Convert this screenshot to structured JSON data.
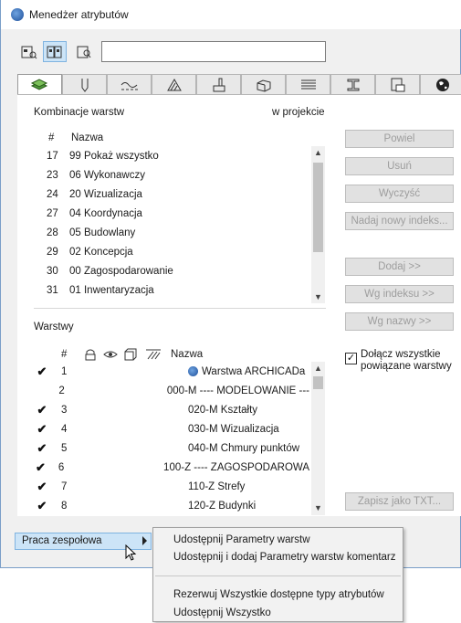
{
  "window": {
    "title": "Menedżer atrybutów"
  },
  "toolbar": {
    "buttons": [
      {
        "icon": "attribute-view-icon"
      },
      {
        "icon": "attribute-compare-icon"
      },
      {
        "icon": "attribute-preview-icon"
      }
    ],
    "search_value": ""
  },
  "tabs": [
    {
      "icon": "layers-icon",
      "active": true
    },
    {
      "icon": "pens-icon"
    },
    {
      "icon": "line-types-icon"
    },
    {
      "icon": "fill-types-icon"
    },
    {
      "icon": "surfaces-icon"
    },
    {
      "icon": "building-materials-icon"
    },
    {
      "icon": "composites-icon"
    },
    {
      "icon": "profiles-icon"
    },
    {
      "icon": "zone-categories-icon"
    },
    {
      "icon": "mep-systems-icon"
    },
    {
      "icon": "more-icon"
    }
  ],
  "combos": {
    "section_label": "Kombinacje warstw",
    "in_project_label": "w projekcie",
    "headers": {
      "num": "#",
      "name": "Nazwa"
    },
    "rows": [
      {
        "num": "17",
        "name": "99 Pokaż wszystko"
      },
      {
        "num": "23",
        "name": "06 Wykonawczy"
      },
      {
        "num": "24",
        "name": "20 Wizualizacja"
      },
      {
        "num": "27",
        "name": "04 Koordynacja"
      },
      {
        "num": "28",
        "name": "05 Budowlany"
      },
      {
        "num": "29",
        "name": "02 Koncepcja"
      },
      {
        "num": "30",
        "name": "00 Zagospodarowanie"
      },
      {
        "num": "31",
        "name": "01 Inwentaryzacja"
      }
    ]
  },
  "buttons": {
    "powiel": "Powiel",
    "usun": "Usuń",
    "wyczysc": "Wyczyść",
    "nadaj": "Nadaj nowy indeks...",
    "dodaj": "Dodaj >>",
    "wg_indeksu": "Wg indeksu >>",
    "wg_nazwy": "Wg nazwy >>",
    "zapisz": "Zapisz jako TXT..."
  },
  "layers": {
    "section_label": "Warstwy",
    "headers": {
      "num": "#",
      "name": "Nazwa"
    },
    "rows": [
      {
        "checked": true,
        "num": "1",
        "name": "Warstwa ARCHICADa",
        "special": true
      },
      {
        "checked": false,
        "num": "2",
        "name": "000-M ---- MODELOWANIE ---"
      },
      {
        "checked": true,
        "num": "3",
        "name": "020-M Kształty"
      },
      {
        "checked": true,
        "num": "4",
        "name": "030-M Wizualizacja"
      },
      {
        "checked": true,
        "num": "5",
        "name": "040-M Chmury punktów"
      },
      {
        "checked": true,
        "num": "6",
        "name": "100-Z ---- ZAGOSPODAROWA"
      },
      {
        "checked": true,
        "num": "7",
        "name": "110-Z Strefy"
      },
      {
        "checked": true,
        "num": "8",
        "name": "120-Z Budynki"
      }
    ]
  },
  "include_linked": {
    "checked": true,
    "line1": "Dołącz wszystkie",
    "line2": "powiązane warstwy"
  },
  "team_button": {
    "label": "Praca zespołowa"
  },
  "context_menu": {
    "items": [
      "Udostępnij Parametry warstw",
      "Udostępnij i dodaj Parametry warstw komentarz",
      "Rezerwuj Wszystkie dostępne typy atrybutów",
      "Udostępnij Wszystko"
    ]
  }
}
